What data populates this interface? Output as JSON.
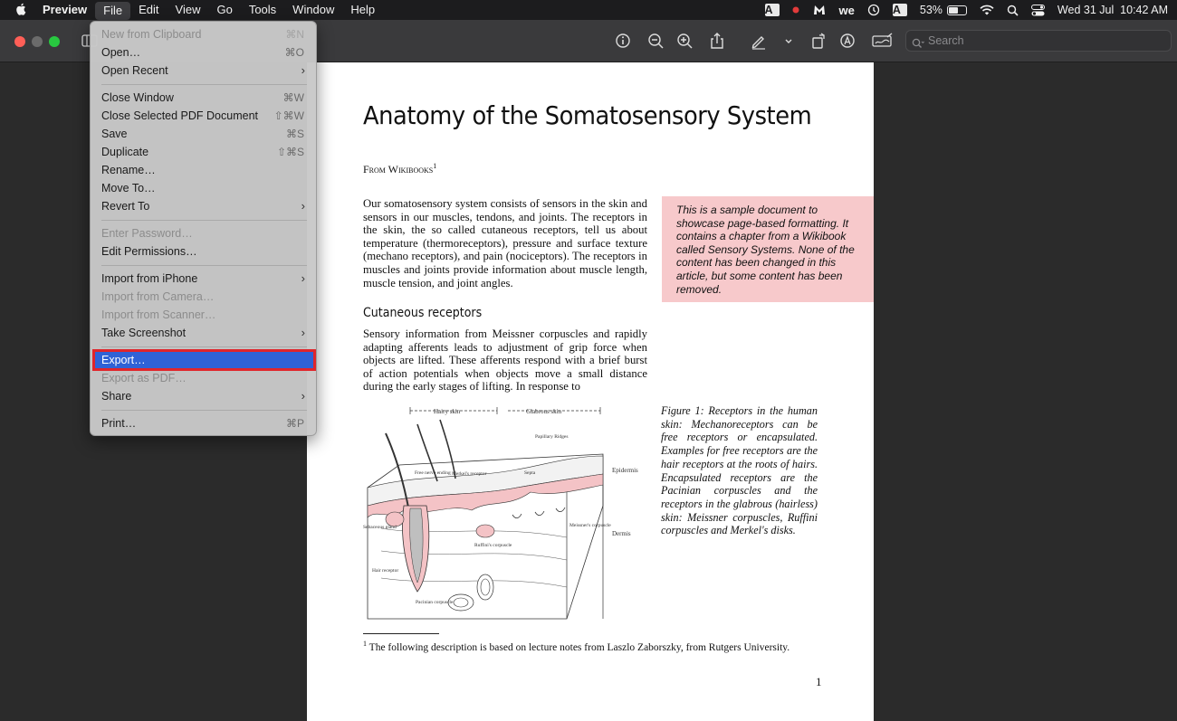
{
  "menubar": {
    "apple": "",
    "items": [
      "Preview",
      "File",
      "Edit",
      "View",
      "Go",
      "Tools",
      "Window",
      "Help"
    ],
    "status": {
      "battery": "53%",
      "datetime": "Wed 31 Jul  10:42 AM",
      "input_source": "A"
    }
  },
  "toolbar": {
    "search_placeholder": "Search"
  },
  "file_menu": {
    "items": [
      {
        "label": "New from Clipboard",
        "shortcut": "⌘N",
        "enabled": false
      },
      {
        "label": "Open…",
        "shortcut": "⌘O",
        "enabled": true
      },
      {
        "label": "Open Recent",
        "submenu": true,
        "enabled": true
      },
      {
        "label": "Close Window",
        "shortcut": "⌘W",
        "enabled": true
      },
      {
        "label": "Close Selected PDF Document",
        "shortcut": "⇧⌘W",
        "enabled": true
      },
      {
        "label": "Save",
        "shortcut": "⌘S",
        "enabled": true
      },
      {
        "label": "Duplicate",
        "shortcut": "⇧⌘S",
        "enabled": true
      },
      {
        "label": "Rename…",
        "enabled": true
      },
      {
        "label": "Move To…",
        "enabled": true
      },
      {
        "label": "Revert To",
        "submenu": true,
        "enabled": true
      },
      {
        "label": "Enter Password…",
        "enabled": false
      },
      {
        "label": "Edit Permissions…",
        "enabled": true
      },
      {
        "label": "Import from iPhone",
        "submenu": true,
        "enabled": true
      },
      {
        "label": "Import from Camera…",
        "enabled": false
      },
      {
        "label": "Import from Scanner…",
        "enabled": false
      },
      {
        "label": "Take Screenshot",
        "submenu": true,
        "enabled": true
      },
      {
        "label": "Export…",
        "enabled": true,
        "highlighted": true
      },
      {
        "label": "Export as PDF…",
        "enabled": false
      },
      {
        "label": "Share",
        "submenu": true,
        "enabled": true
      },
      {
        "label": "Print…",
        "shortcut": "⌘P",
        "enabled": true
      }
    ]
  },
  "document": {
    "title": "Anatomy of the Somatosensory System",
    "byline": "From Wikibooks",
    "byline_note": "1",
    "paragraph1": "Our somatosensory system consists of sensors in the skin and sensors in our muscles, tendons, and joints. The receptors in the skin, the so called cutaneous receptors, tell us about temperature (thermoreceptors), pressure and surface texture (mechano receptors), and pain (nociceptors). The receptors in muscles and joints provide information about muscle length, muscle tension, and joint angles.",
    "section_heading": "Cutaneous receptors",
    "paragraph2": "Sensory information from Meissner corpuscles and rapidly adapting afferents leads to adjustment of grip force when objects are lifted. These afferents respond with a brief burst of action potentials when objects move a small distance during the early stages of lifting. In response to",
    "note_box": "This is a sample document to showcase page-based formatting. It contains a chapter from a Wikibook called Sensory Systems. None of the content has been changed in this article, but some content has been removed.",
    "figure_caption": "Figure 1:  Receptors in the human skin: Mechanoreceptors can be free receptors or encapsulated. Examples for free receptors are the hair receptors at the roots of hairs. Encapsulated receptors are the Pacinian corpuscles and the receptors in the glabrous (hairless) skin: Meissner corpuscles, Ruffini corpuscles and Merkel's disks.",
    "figure_labels": {
      "hairy_skin": "Hairy skin",
      "glabrous_skin": "Glabrous skin",
      "papillary_ridges": "Papillary Ridges",
      "free_nerve": "Free nerve ending",
      "merkel": "Merkel's receptor",
      "septa": "Septa",
      "epidermis": "Epidermis",
      "dermis": "Dermis",
      "sebaceous": "Sebaceous gland",
      "ruffini": "Ruffini's corpuscle",
      "meissner": "Meissner's corpuscle",
      "hair_receptor": "Hair receptor",
      "pacinian": "Pacinian corpuscle"
    },
    "footnote_num": "1",
    "footnote": "The following description is based on lecture notes from Laszlo Zaborszky, from Rutgers University.",
    "page_number": "1"
  }
}
